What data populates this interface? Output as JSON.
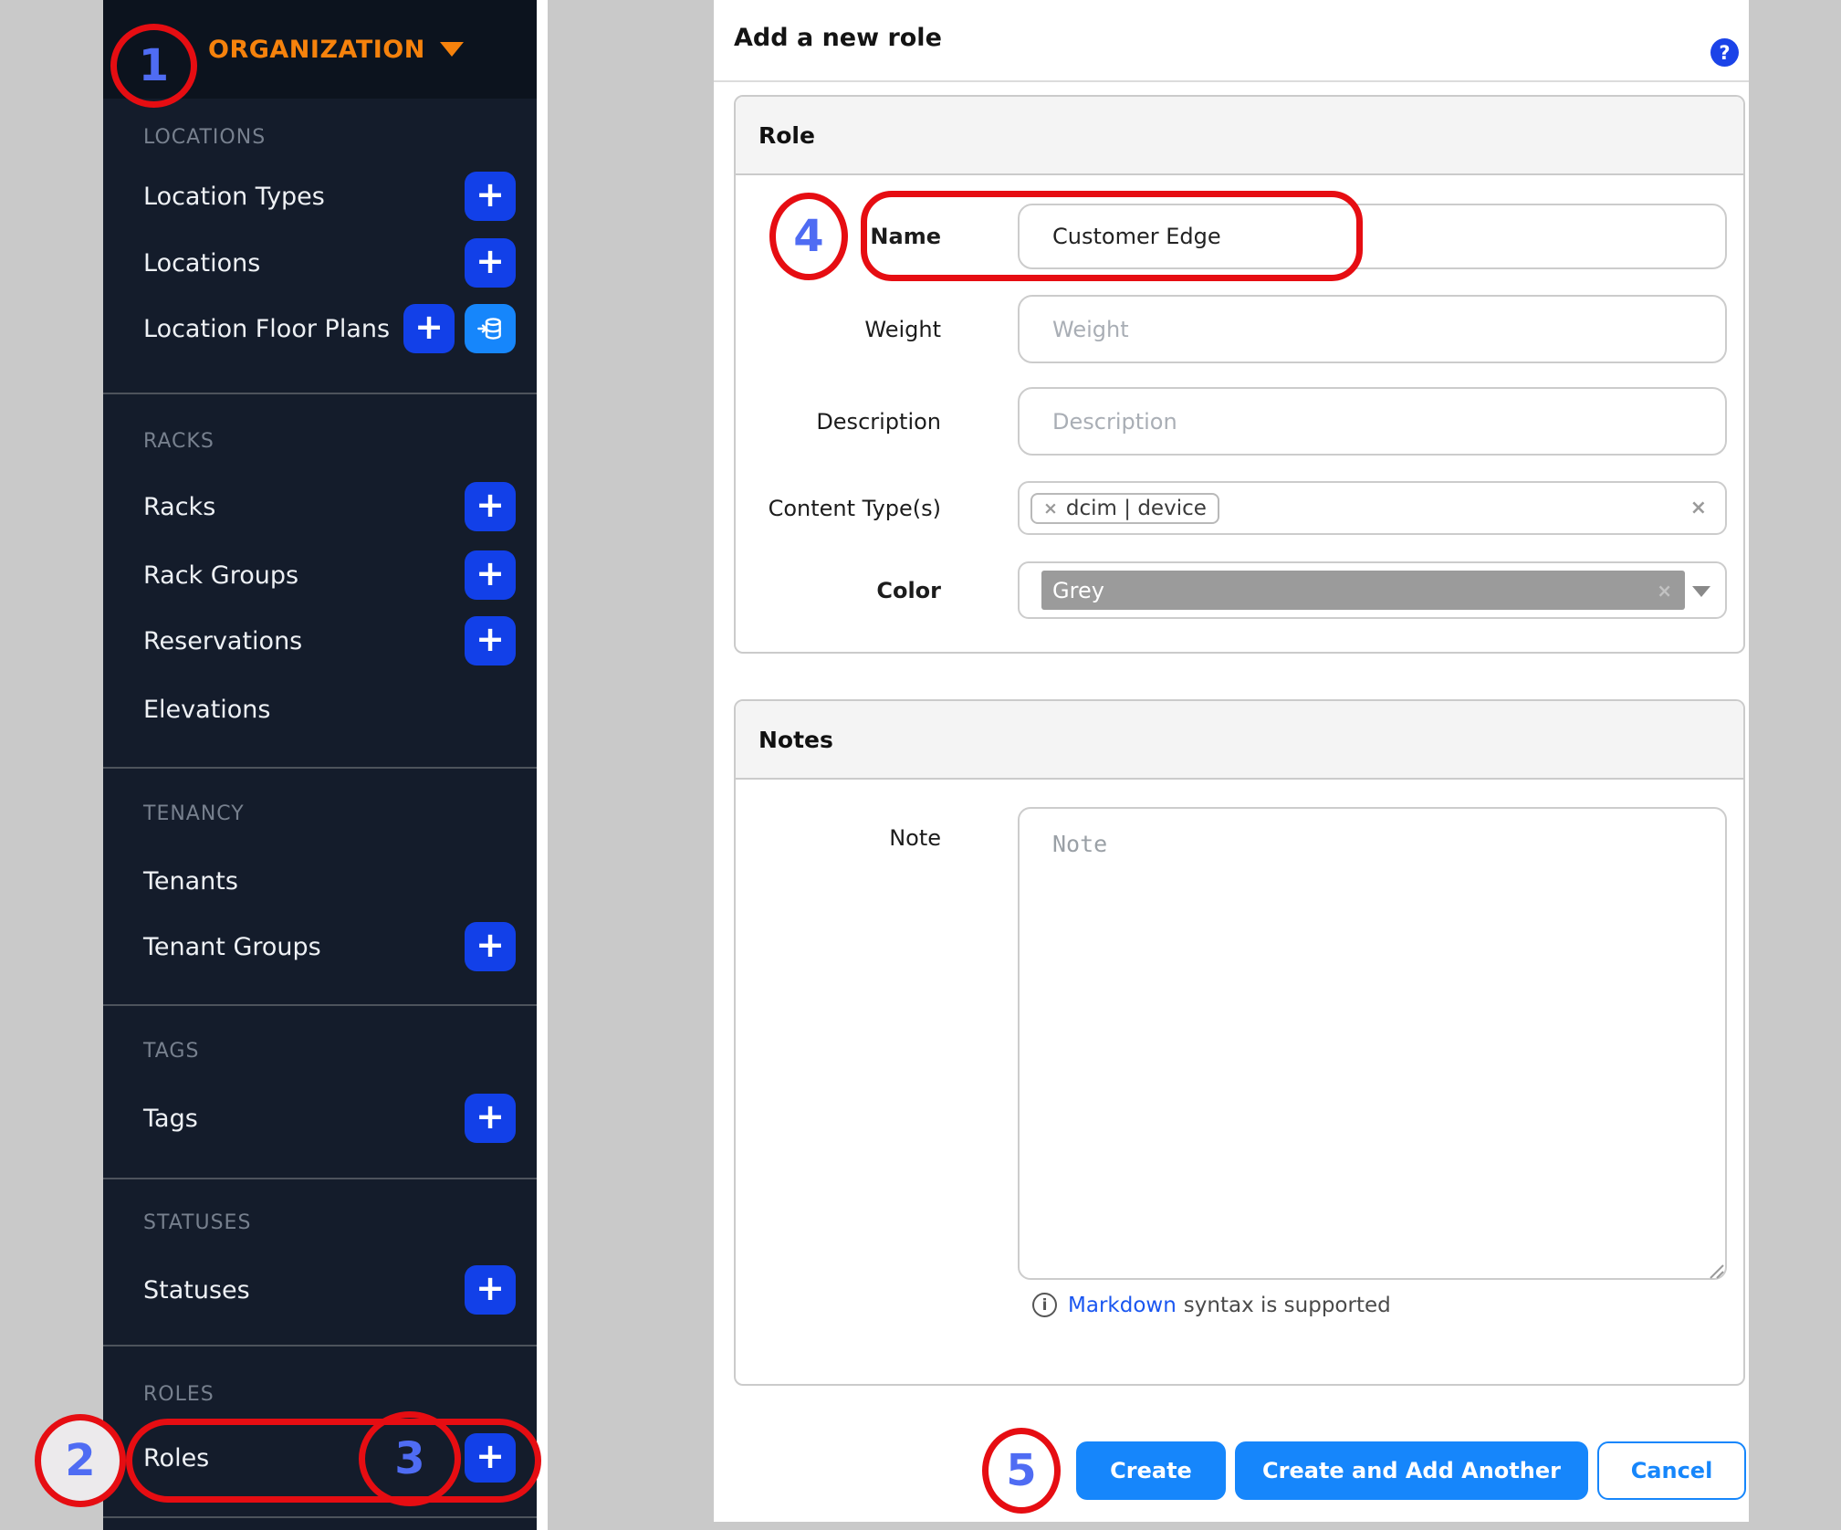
{
  "icons": {
    "plus": "+",
    "help": "?",
    "info": "i",
    "tag_remove": "×",
    "clear": "×",
    "grey_clear": "×"
  },
  "annotations": {
    "n1": "1",
    "n2": "2",
    "n3": "3",
    "n4": "4",
    "n5": "5"
  },
  "colors": {
    "sidebar_bg": "#141c2b",
    "accent_orange": "#f6820c",
    "deep_blue": "#1240e8",
    "bright_blue": "#1686fb",
    "annotation_red": "#e60d12",
    "annotation_number_blue": "#4f6cf3",
    "grey_swatch": "#9b9b9b"
  },
  "sidebar": {
    "header": {
      "label": "ORGANIZATION"
    },
    "sections": [
      {
        "label": "LOCATIONS",
        "items": [
          {
            "label": "Location Types"
          },
          {
            "label": "Locations"
          },
          {
            "label": "Location Floor Plans"
          }
        ]
      },
      {
        "label": "RACKS",
        "items": [
          {
            "label": "Racks"
          },
          {
            "label": "Rack Groups"
          },
          {
            "label": "Reservations"
          },
          {
            "label": "Elevations"
          }
        ]
      },
      {
        "label": "TENANCY",
        "items": [
          {
            "label": "Tenants"
          },
          {
            "label": "Tenant Groups"
          }
        ]
      },
      {
        "label": "TAGS",
        "items": [
          {
            "label": "Tags"
          }
        ]
      },
      {
        "label": "STATUSES",
        "items": [
          {
            "label": "Statuses"
          }
        ]
      },
      {
        "label": "ROLES",
        "items": [
          {
            "label": "Roles"
          }
        ]
      }
    ]
  },
  "main": {
    "title": "Add a new role",
    "role_card": {
      "title": "Role",
      "name_label": "Name",
      "name_value": "Customer Edge",
      "weight_label": "Weight",
      "weight_placeholder": "Weight",
      "description_label": "Description",
      "description_placeholder": "Description",
      "content_types_label": "Content Type(s)",
      "content_types_tag": "dcim | device",
      "color_label": "Color",
      "color_value": "Grey"
    },
    "notes_card": {
      "title": "Notes",
      "note_label": "Note",
      "note_placeholder": "Note",
      "hint_link": "Markdown",
      "hint_text": "syntax is supported"
    },
    "buttons": {
      "create": "Create",
      "create_add": "Create and Add Another",
      "cancel": "Cancel"
    }
  }
}
